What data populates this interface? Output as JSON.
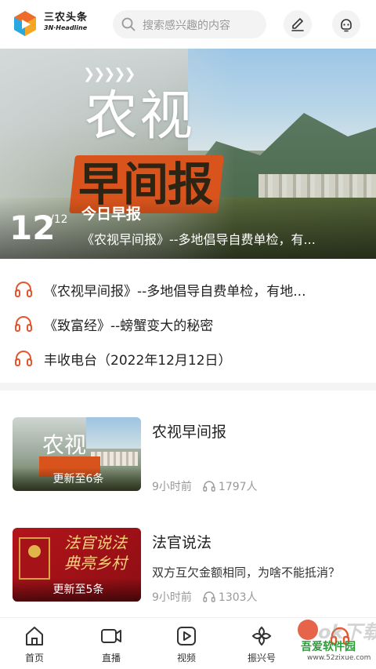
{
  "header": {
    "logo_cn": "三农头条",
    "logo_en": "3N·Headline",
    "search_placeholder": "搜索感兴趣的内容"
  },
  "banner": {
    "brand_line1": "农视",
    "brand_line2": "早间报",
    "page_current": "12",
    "page_total": "/12",
    "title": "今日早报",
    "subtitle": "《农视早间报》--多地倡导自费单检，有..."
  },
  "audio_items": [
    {
      "text": "《农视早间报》--多地倡导自费单检，有地..."
    },
    {
      "text": "《致富经》--螃蟹变大的秘密"
    },
    {
      "text": "丰收电台（2022年12月12日）"
    }
  ],
  "cards": [
    {
      "title": "农视早间报",
      "description": "",
      "thumb_brand": "农视",
      "thumb_caption": "更新至6条",
      "time": "9小时前",
      "listeners": "1797人"
    },
    {
      "title": "法官说法",
      "description": "双方互欠金额相同，为啥不能抵消？",
      "thumb_calligraphy": "法官说法 典亮乡村",
      "thumb_caption": "更新至5条",
      "time": "9小时前",
      "listeners": "1303人"
    }
  ],
  "nav": [
    {
      "label": "首页",
      "icon": "home-icon"
    },
    {
      "label": "直播",
      "icon": "video-camera-icon"
    },
    {
      "label": "视频",
      "icon": "play-icon"
    },
    {
      "label": "振兴号",
      "icon": "flower-icon"
    },
    {
      "label": "",
      "icon": "headphones-icon"
    }
  ],
  "watermark": {
    "logo": "ok下载",
    "site_name": "吾爱软件园",
    "site_url": "www.52zixue.com"
  },
  "colors": {
    "accent": "#e4572e",
    "audio_icon": "#e4572e",
    "muted": "#999999"
  }
}
